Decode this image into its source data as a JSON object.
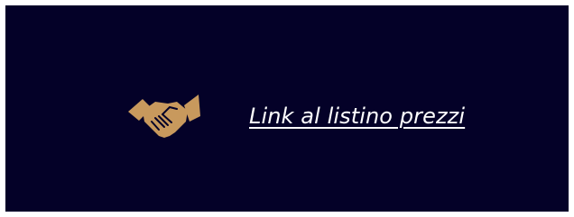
{
  "colors": {
    "background": "#040128",
    "icon": "#c8995d",
    "link_text": "#ffffff"
  },
  "icon": {
    "name": "handshake-icon"
  },
  "link": {
    "label": "Link al listino prezzi"
  }
}
